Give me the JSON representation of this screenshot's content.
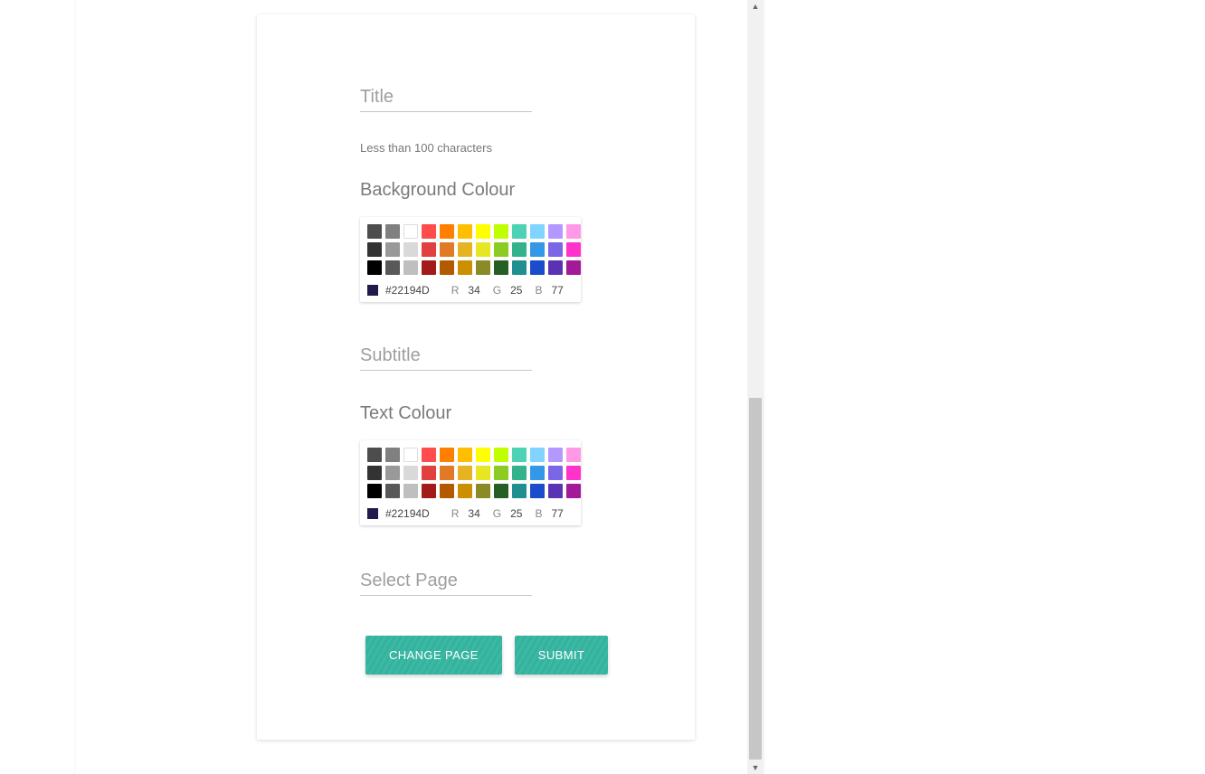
{
  "form": {
    "title_placeholder": "Title",
    "title_value": "",
    "title_hint": "Less than 100 characters",
    "subtitle_placeholder": "Subtitle",
    "subtitle_value": "",
    "selectpage_placeholder": "Select Page",
    "selectpage_value": ""
  },
  "sections": {
    "background_colour": "Background Colour",
    "text_colour": "Text Colour"
  },
  "palette_rows": [
    [
      "#4d4d4d",
      "#808080",
      "#ffffff",
      "#ff4d4d",
      "#ff8000",
      "#ffbf00",
      "#ffff00",
      "#bfff00",
      "#4dd2b3",
      "#80d4ff",
      "#b399ff",
      "#ff99e6"
    ],
    [
      "#333333",
      "#999999",
      "#d9d9d9",
      "#e04040",
      "#e07a26",
      "#e6b322",
      "#e6e622",
      "#8ccc22",
      "#33b38c",
      "#3399e6",
      "#7a66e6",
      "#ff33cc"
    ],
    [
      "#000000",
      "#595959",
      "#bfbfbf",
      "#a31a1a",
      "#b35900",
      "#cc8f00",
      "#8a8a26",
      "#265f26",
      "#1f8f8f",
      "#1a4ccc",
      "#5933b3",
      "#a31a99"
    ]
  ],
  "selected_colour": {
    "hex": "#22194D",
    "r": "34",
    "g": "25",
    "b": "77"
  },
  "labels": {
    "r": "R",
    "g": "G",
    "b": "B"
  },
  "buttons": {
    "change_page": "Change Page",
    "submit": "Submit"
  }
}
